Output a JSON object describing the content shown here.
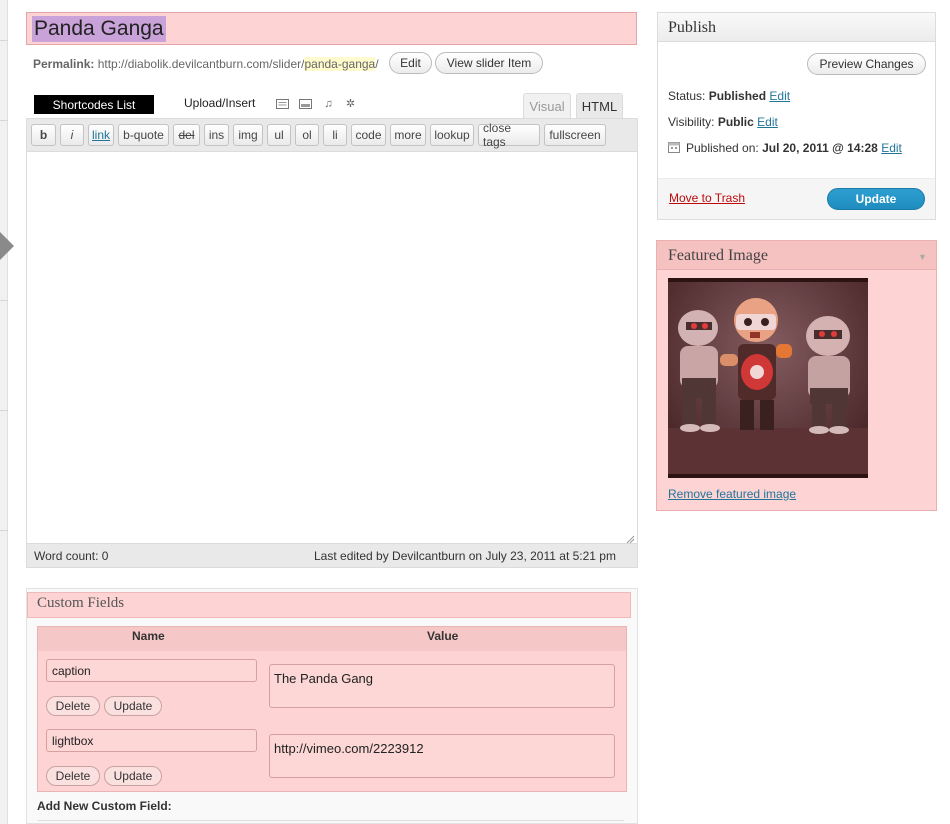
{
  "post": {
    "title": "Panda Ganga",
    "permalink_label": "Permalink:",
    "permalink_base": "http://diabolik.devilcantburn.com/slider/",
    "permalink_slug": "panda-ganga",
    "permalink_trailing": "/",
    "edit_button": "Edit",
    "view_button": "View slider Item"
  },
  "media": {
    "shortcodes_label": "Shortcodes List",
    "upload_label": "Upload/Insert",
    "icons": [
      "image-icon",
      "video-icon",
      "audio-icon",
      "media-icon"
    ]
  },
  "editor": {
    "tabs": [
      "Visual",
      "HTML"
    ],
    "active_tab": "HTML",
    "quicktags": [
      "b",
      "i",
      "link",
      "b-quote",
      "del",
      "ins",
      "img",
      "ul",
      "ol",
      "li",
      "code",
      "more",
      "lookup",
      "close tags",
      "fullscreen"
    ],
    "content": "",
    "word_count": "Word count: 0",
    "last_edited": "Last edited by Devilcantburn on July 23, 2011 at 5:21 pm"
  },
  "custom_fields": {
    "title": "Custom Fields",
    "col_name": "Name",
    "col_value": "Value",
    "rows": [
      {
        "name": "caption",
        "value": "The Panda Gang",
        "delete": "Delete",
        "update": "Update"
      },
      {
        "name": "lightbox",
        "value": "http://vimeo.com/2223912",
        "delete": "Delete",
        "update": "Update"
      }
    ],
    "add_new_label": "Add New Custom Field:"
  },
  "publish": {
    "title": "Publish",
    "preview_button": "Preview Changes",
    "status_label": "Status:",
    "status_value": "Published",
    "visibility_label": "Visibility:",
    "visibility_value": "Public",
    "published_label": "Published on:",
    "published_value": "Jul 20, 2011 @ 14:28",
    "edit_link": "Edit",
    "trash_link": "Move to Trash",
    "update_button": "Update"
  },
  "featured_image": {
    "title": "Featured Image",
    "remove_link": "Remove featured image"
  },
  "colors": {
    "highlight": "#fdd3d3",
    "link": "#21759b",
    "primary_button": "#1e8cbe",
    "trash": "#bc0b0b"
  }
}
